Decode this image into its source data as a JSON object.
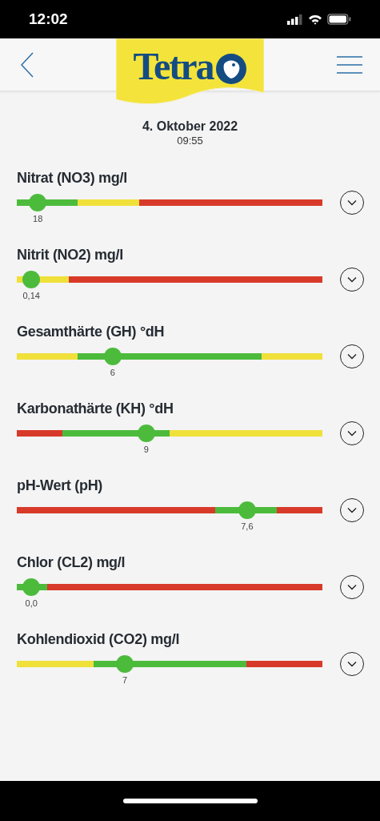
{
  "status_bar": {
    "time": "12:02"
  },
  "header": {
    "logo": "Tetra"
  },
  "date": "4. Oktober 2022",
  "time": "09:55",
  "parameters": [
    {
      "name": "Nitrat (NO3) mg/l",
      "value": "18",
      "level": 0.045,
      "expanded": false,
      "track": {
        "color": "#d83a2a"
      },
      "zones": [
        {
          "color": "#4cbb3c",
          "level": 0.2
        },
        {
          "color": "#f0e03a",
          "level": 0.4
        }
      ]
    },
    {
      "name": "Nitrit (NO2) mg/l",
      "value": "0,14",
      "level": 0.024,
      "expanded": false,
      "track": {
        "color": "#d83a2a"
      },
      "zones": [
        {
          "color": "#f0e03a",
          "level": 0.17
        }
      ]
    },
    {
      "name": "Gesamthärte (GH) °dH",
      "value": "6",
      "level": 0.29,
      "expanded": false,
      "track": {
        "color": "#f0e03a"
      },
      "zones": [
        {
          "color": "#f0e03a",
          "level": 0.2
        },
        {
          "color": "#4cbb3c",
          "level": 0.8
        }
      ]
    },
    {
      "name": "Karbonathärte (KH) °dH",
      "value": "9",
      "level": 0.4,
      "expanded": false,
      "track": {
        "color": "#f0e03a"
      },
      "zones": [
        {
          "color": "#d83a2a",
          "level": 0.15
        },
        {
          "color": "#4cbb3c",
          "level": 0.5
        }
      ]
    },
    {
      "name": "pH-Wert (pH)",
      "value": "7,6",
      "level": 0.73,
      "expanded": false,
      "track": {
        "color": "#d83a2a"
      },
      "zones": [
        {
          "color": "#d83a2a",
          "level": 0.65
        },
        {
          "color": "#4cbb3c",
          "level": 0.85
        }
      ]
    },
    {
      "name": "Chlor (CL2) mg/l",
      "value": "0,0",
      "level": 0.024,
      "expanded": false,
      "track": {
        "color": "#d83a2a"
      },
      "zones": [
        {
          "color": "#4cbb3c",
          "level": 0.1
        }
      ]
    },
    {
      "name": "Kohlendioxid (CO2) mg/l",
      "value": "7",
      "level": 0.33,
      "expanded": false,
      "track": {
        "color": "#d83a2a"
      },
      "zones": [
        {
          "color": "#f0e03a",
          "level": 0.25
        },
        {
          "color": "#4cbb3c",
          "level": 0.75
        }
      ]
    }
  ]
}
